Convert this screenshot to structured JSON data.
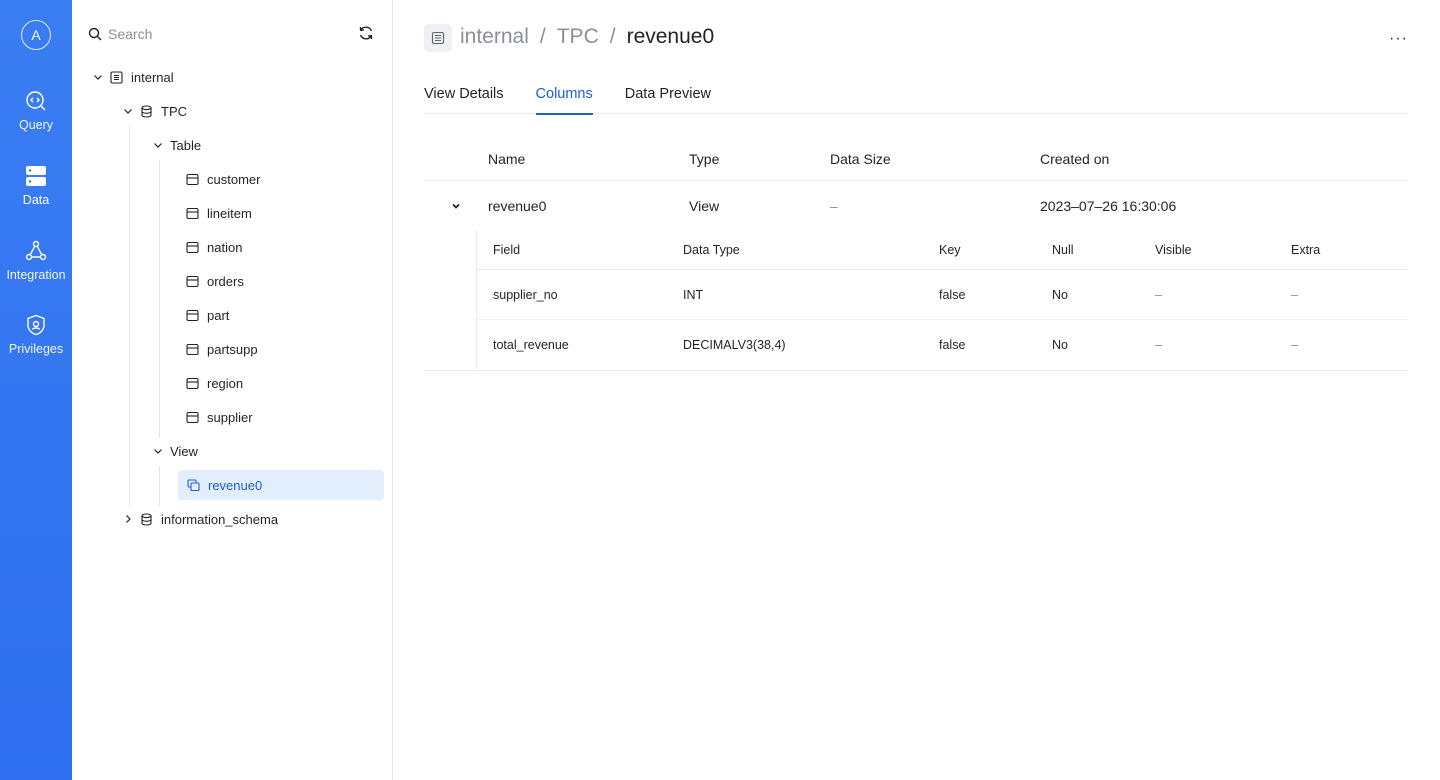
{
  "rail": {
    "avatar": "A",
    "items": [
      {
        "label": "Query",
        "icon": "query-icon"
      },
      {
        "label": "Data",
        "icon": "data-icon"
      },
      {
        "label": "Integration",
        "icon": "integration-icon"
      },
      {
        "label": "Privileges",
        "icon": "privileges-icon"
      }
    ]
  },
  "tree": {
    "search_placeholder": "Search",
    "catalog": "internal",
    "database": "TPC",
    "table_group": "Table",
    "tables": [
      "customer",
      "lineitem",
      "nation",
      "orders",
      "part",
      "partsupp",
      "region",
      "supplier"
    ],
    "view_group": "View",
    "views": [
      "revenue0"
    ],
    "other_database": "information_schema"
  },
  "header": {
    "breadcrumb": [
      "internal",
      "TPC",
      "revenue0"
    ],
    "separator": "/",
    "more": "···"
  },
  "tabs": [
    "View Details",
    "Columns",
    "Data Preview"
  ],
  "active_tab": "Columns",
  "table": {
    "headers": [
      "Name",
      "Type",
      "Data Size",
      "Created on"
    ],
    "row": {
      "name": "revenue0",
      "type": "View",
      "size": "–",
      "created": "2023–07–26 16:30:06"
    }
  },
  "columns": {
    "headers": [
      "Field",
      "Data Type",
      "Key",
      "Null",
      "Visible",
      "Extra"
    ],
    "rows": [
      {
        "field": "supplier_no",
        "type": "INT",
        "key": "false",
        "null": "No",
        "visible": "–",
        "extra": "–"
      },
      {
        "field": "total_revenue",
        "type": "DECIMALV3(38,4)",
        "key": "false",
        "null": "No",
        "visible": "–",
        "extra": "–"
      }
    ]
  },
  "colors": {
    "rail": "#2f6ff0",
    "accent": "#1d5fcf",
    "selected_bg": "#e3eefd"
  }
}
